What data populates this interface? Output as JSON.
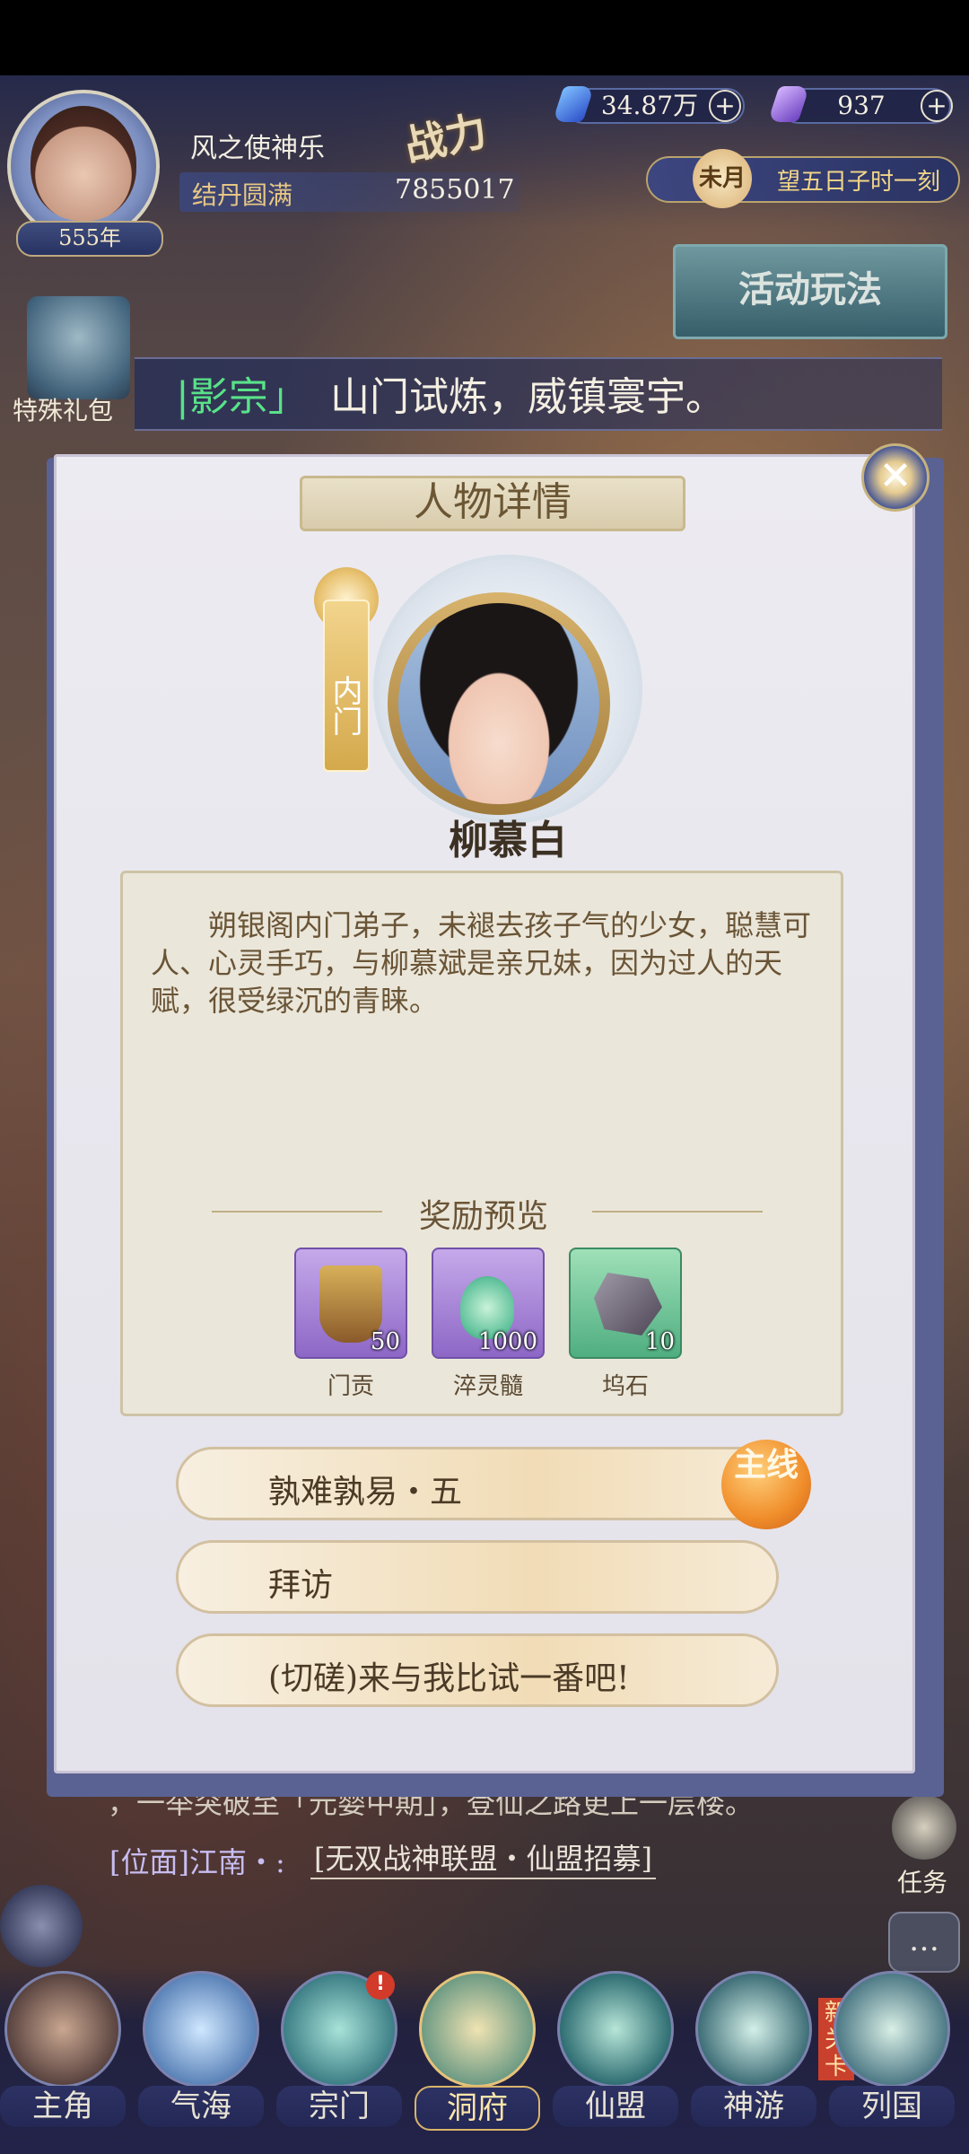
{
  "player": {
    "name": "风之使神乐",
    "realm": "结丹圆满",
    "age": "555年",
    "combat_label": "战力",
    "combat_power": "7855017"
  },
  "resources": {
    "spirit_stone": "34.87万",
    "jade": "937",
    "plus": "+"
  },
  "time": {
    "moon": "未月",
    "text": "望五日子时一刻"
  },
  "activity_banner": "活动玩法",
  "left_menu": {
    "gift": "特殊礼包"
  },
  "notice": {
    "sect": "|影宗」",
    "text": "山门试炼，威镇寰宇。"
  },
  "modal": {
    "title": "人物详情",
    "close": "✕",
    "tag": "内门",
    "name": "柳慕白",
    "description": "朔银阁内门弟子，未褪去孩子气的少女，聪慧可人、心灵手巧，与柳慕斌是亲兄妹，因为过人的天赋，很受绿沉的青睐。",
    "reward_title": "奖励预览",
    "rewards": [
      {
        "name": "门贡",
        "count": "50",
        "color": "#a98ad0"
      },
      {
        "name": "淬灵髓",
        "count": "1000",
        "color": "#a98ad0"
      },
      {
        "name": "坞石",
        "count": "10",
        "color": "#6cbf8f"
      }
    ],
    "choices": [
      {
        "label": "孰难孰易・五"
      },
      {
        "label": "拜访"
      },
      {
        "label": "(切磋)来与我比试一番吧!"
      }
    ],
    "main_badge": "主线"
  },
  "news": {
    "line1": "，一举突破至「元婴中期」，登仙之路更上一层楼。",
    "line2_prefix": "[位面]江南・:",
    "line2_link": "[无双战神联盟・仙盟招募]"
  },
  "side": {
    "task": "任务",
    "chat": "…"
  },
  "nav": [
    {
      "label": "主角"
    },
    {
      "label": "气海"
    },
    {
      "label": "宗门"
    },
    {
      "label": "洞府"
    },
    {
      "label": "仙盟"
    },
    {
      "label": "神游"
    },
    {
      "label": "列国"
    }
  ],
  "nav_badge": "!",
  "new_stage": "新关卡"
}
